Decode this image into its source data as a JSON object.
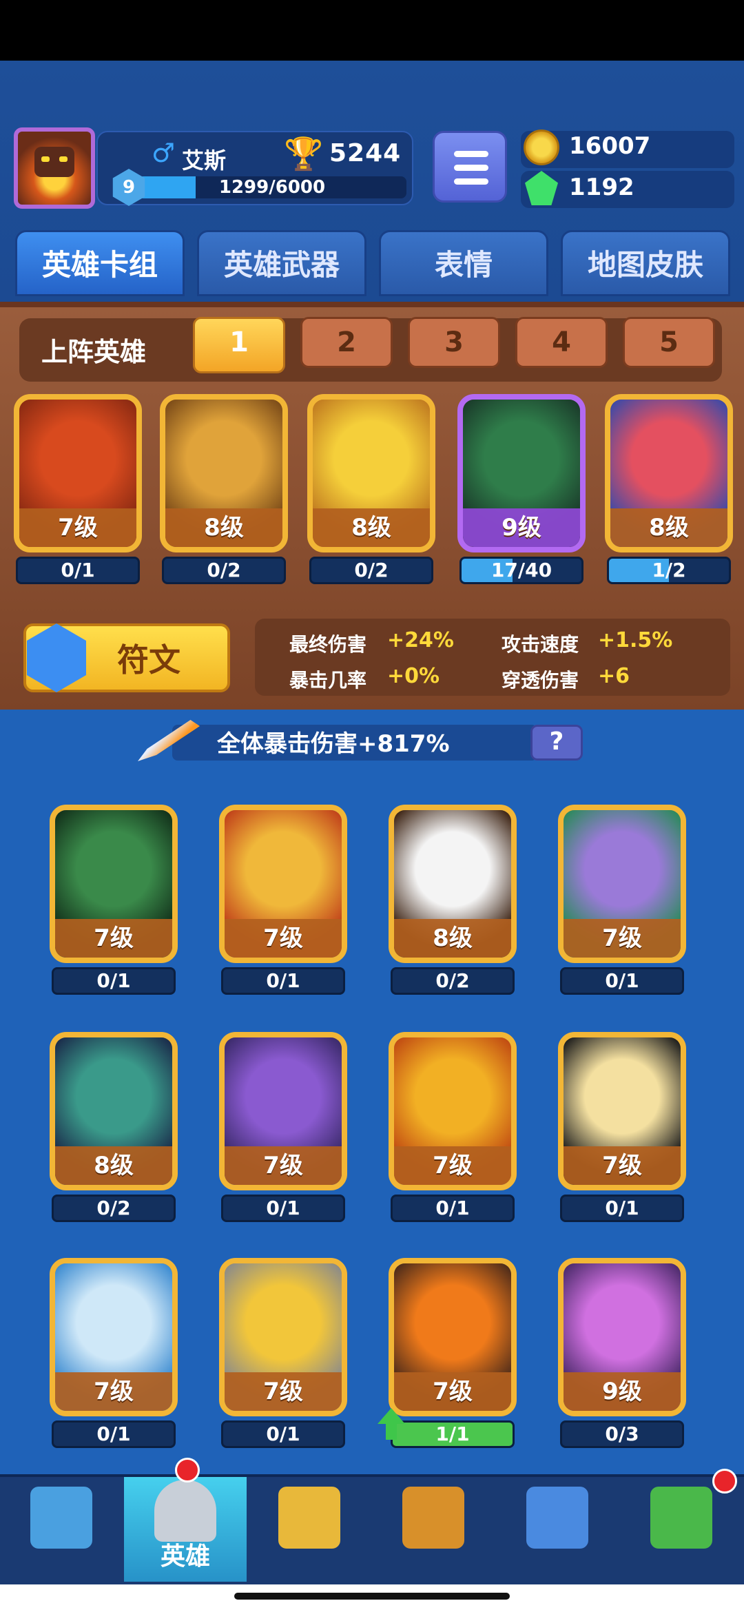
{
  "player": {
    "name": "艾斯",
    "gender_symbol": "♂",
    "trophies": "5244",
    "level": "9",
    "xp_text": "1299/6000",
    "xp_fraction": 0.2165
  },
  "currency": {
    "coins": "16007",
    "gems": "1192"
  },
  "tabs": [
    {
      "label": "英雄卡组",
      "active": true
    },
    {
      "label": "英雄武器",
      "active": false
    },
    {
      "label": "表情",
      "active": false
    },
    {
      "label": "地图皮肤",
      "active": false
    }
  ],
  "deck": {
    "label": "上阵英雄",
    "slots": [
      "1",
      "2",
      "3",
      "4",
      "5"
    ],
    "active_slot": 0,
    "heroes": [
      {
        "level": "7级",
        "progress": "0/1",
        "fraction": 0,
        "colors": [
          "#d84a1e",
          "#8a2a12"
        ]
      },
      {
        "level": "8级",
        "progress": "0/2",
        "fraction": 0,
        "colors": [
          "#e0a33a",
          "#7a4a18"
        ]
      },
      {
        "level": "8级",
        "progress": "0/2",
        "fraction": 0,
        "colors": [
          "#f5cf3a",
          "#c07a20"
        ]
      },
      {
        "level": "9级",
        "progress": "17/40",
        "fraction": 0.425,
        "colors": [
          "#2f7d4a",
          "#1a3a2a"
        ],
        "purple": true
      },
      {
        "level": "8级",
        "progress": "1/2",
        "fraction": 0.5,
        "colors": [
          "#e45060",
          "#3a4aa8"
        ]
      }
    ]
  },
  "rune": {
    "label": "符文",
    "stats": [
      {
        "label": "最终伤害",
        "value": "+24%"
      },
      {
        "label": "攻击速度",
        "value": "+1.5%"
      },
      {
        "label": "暴击几率",
        "value": "+0%"
      },
      {
        "label": "穿透伤害",
        "value": "+6"
      }
    ]
  },
  "total_crit": {
    "text": "全体暴击伤害+817%",
    "help": "?"
  },
  "collection": [
    {
      "level": "7级",
      "progress": "0/1",
      "fraction": 0,
      "colors": [
        "#3a8a4a",
        "#12301a"
      ]
    },
    {
      "level": "7级",
      "progress": "0/1",
      "fraction": 0,
      "colors": [
        "#f0b83a",
        "#c0401a"
      ]
    },
    {
      "level": "8级",
      "progress": "0/2",
      "fraction": 0,
      "colors": [
        "#f4f4f4",
        "#3a2010"
      ]
    },
    {
      "level": "7级",
      "progress": "0/1",
      "fraction": 0,
      "colors": [
        "#9a7ad8",
        "#2a8a5a"
      ]
    },
    {
      "level": "8级",
      "progress": "0/2",
      "fraction": 0,
      "colors": [
        "#3a9a8a",
        "#1a2a4a"
      ]
    },
    {
      "level": "7级",
      "progress": "0/1",
      "fraction": 0,
      "colors": [
        "#8a5ad0",
        "#3a2a6a"
      ]
    },
    {
      "level": "7级",
      "progress": "0/1",
      "fraction": 0,
      "colors": [
        "#f2b024",
        "#c04a12"
      ]
    },
    {
      "level": "7级",
      "progress": "0/1",
      "fraction": 0,
      "colors": [
        "#f4e0a0",
        "#1a1a1a"
      ]
    },
    {
      "level": "7级",
      "progress": "0/1",
      "fraction": 0,
      "colors": [
        "#cfe8f8",
        "#3a8ad0"
      ]
    },
    {
      "level": "7级",
      "progress": "0/1",
      "fraction": 0,
      "colors": [
        "#f2c63a",
        "#8a8a8a"
      ]
    },
    {
      "level": "7级",
      "progress": "1/1",
      "fraction": 1,
      "green": true,
      "colors": [
        "#f07a1a",
        "#4a2a1a"
      ]
    },
    {
      "level": "9级",
      "progress": "0/3",
      "fraction": 0,
      "colors": [
        "#d070e0",
        "#4a2a6a"
      ]
    }
  ],
  "nav": [
    {
      "label": "",
      "icon": "treasure-chest-icon"
    },
    {
      "label": "英雄",
      "icon": "knight-helmet-icon",
      "active": true
    },
    {
      "label": "",
      "icon": "crossed-swords-icon"
    },
    {
      "label": "",
      "icon": "crown-shield-icon"
    },
    {
      "label": "",
      "icon": "team-banner-icon"
    },
    {
      "label": "",
      "icon": "sprout-garden-icon"
    }
  ],
  "colors": {
    "accent_gold": "#f2b636",
    "brand_blue": "#1f62b8",
    "deck_brown": "#8a4e2e"
  }
}
